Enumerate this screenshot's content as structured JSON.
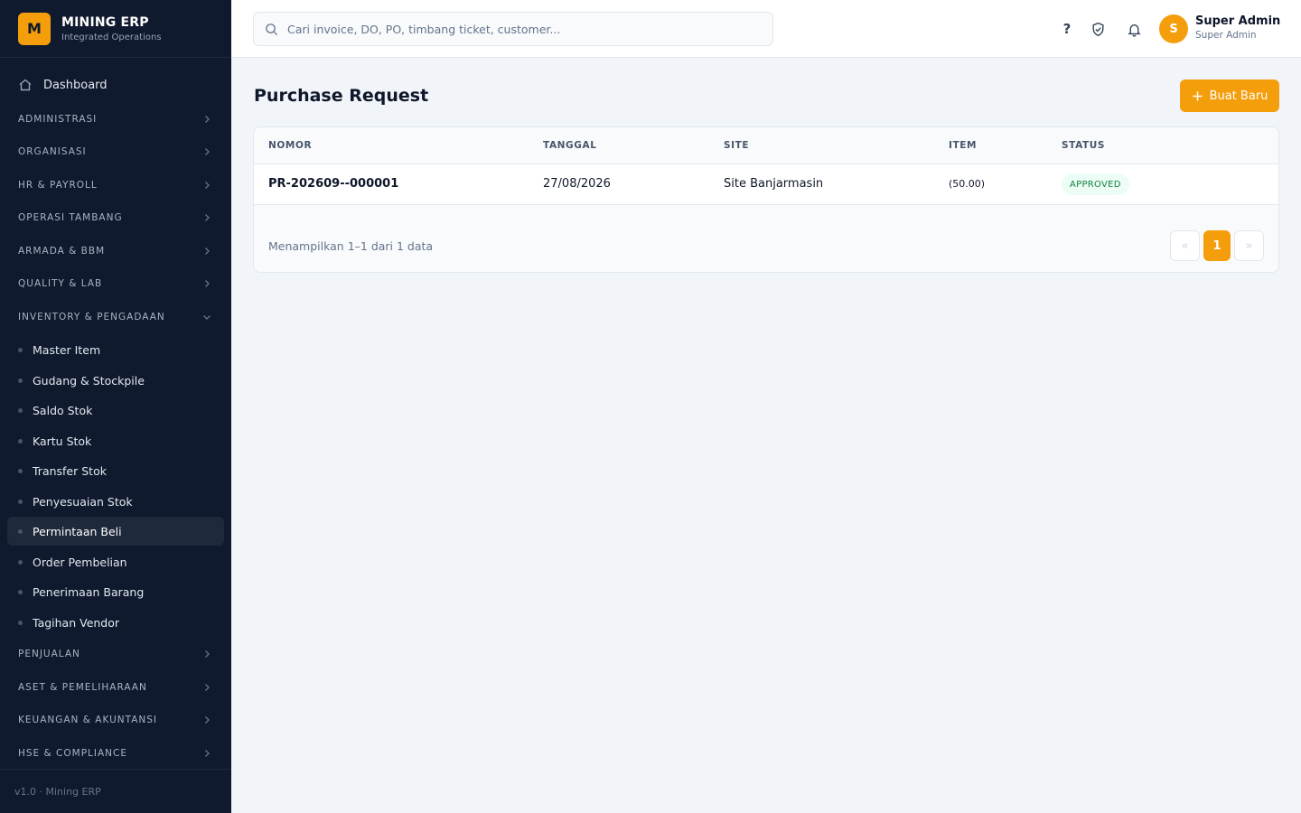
{
  "brand": {
    "logo_letter": "M",
    "title": "MINING ERP",
    "subtitle": "Integrated Operations"
  },
  "sidebar": {
    "dashboard_label": "Dashboard",
    "sections": [
      "ADMINISTRASI",
      "ORGANISASI",
      "HR & PAYROLL",
      "OPERASI TAMBANG",
      "ARMADA & BBM",
      "QUALITY & LAB",
      "INVENTORY & PENGADAAN",
      "PENJUALAN",
      "ASET & PEMELIHARAAN",
      "KEUANGAN & AKUNTANSI",
      "HSE & COMPLIANCE"
    ],
    "inventory_items": [
      "Master Item",
      "Gudang & Stockpile",
      "Saldo Stok",
      "Kartu Stok",
      "Transfer Stok",
      "Penyesuaian Stok",
      "Permintaan Beli",
      "Order Pembelian",
      "Penerimaan Barang",
      "Tagihan Vendor"
    ],
    "active_item": "Permintaan Beli",
    "version": "v1.0 · Mining ERP"
  },
  "topbar": {
    "search_placeholder": "Cari invoice, DO, PO, timbang ticket, customer...",
    "help_label": "?",
    "avatar_letter": "S",
    "user_name": "Super Admin",
    "user_role": "Super Admin"
  },
  "page": {
    "title": "Purchase Request",
    "new_button": "Buat Baru"
  },
  "table": {
    "headers": [
      "NOMOR",
      "TANGGAL",
      "SITE",
      "ITEM",
      "STATUS"
    ],
    "rows": [
      {
        "nomor": "PR-202609--000001",
        "tanggal": "27/08/2026",
        "site": "Site Banjarmasin",
        "item": "(50.00)",
        "status": "APPROVED"
      }
    ],
    "footer": "Menampilkan 1–1 dari 1 data",
    "pagination": {
      "prev": "«",
      "current": "1",
      "next": "»"
    }
  },
  "colors": {
    "accent": "#f59e0b",
    "sidebar_bg": "#101a2e",
    "status_approved": "#15803d"
  }
}
